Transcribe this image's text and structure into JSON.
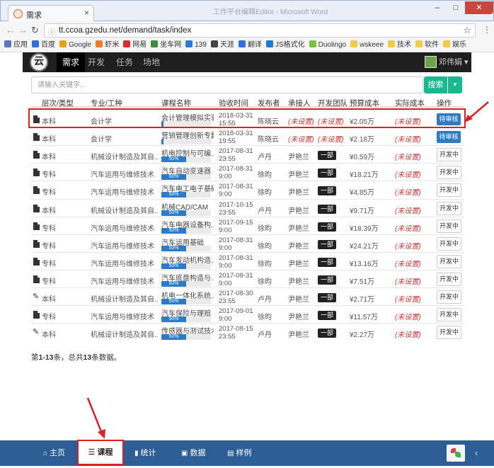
{
  "browser": {
    "tab_title": "需求",
    "caption": "工作平台编辑Editor - Microsoft Word",
    "url": "tt.ccoa.gzedu.net/demand/task/index",
    "bookmarks": [
      {
        "label": "应用",
        "color": "#5a78b8"
      },
      {
        "label": "百度",
        "color": "#2f6fe0"
      },
      {
        "label": "Google",
        "color": "#e8a21a"
      },
      {
        "label": "虾米",
        "color": "#f07b2a"
      },
      {
        "label": "网易",
        "color": "#d62e2e"
      },
      {
        "label": "坐车网",
        "color": "#3a8d3a"
      },
      {
        "label": "139",
        "color": "#2d7bd0"
      },
      {
        "label": "天涯",
        "color": "#444"
      },
      {
        "label": "翻译",
        "color": "#2f6fe0"
      },
      {
        "label": "JS格式化",
        "color": "#1d7bd6"
      },
      {
        "label": "Duolingo",
        "color": "#7ac143"
      },
      {
        "label": "wskeee",
        "color": "#f2c94c"
      },
      {
        "label": "技术",
        "color": "#f2c94c"
      },
      {
        "label": "软件",
        "color": "#f2c94c"
      },
      {
        "label": "娱乐",
        "color": "#f2c94c"
      }
    ]
  },
  "navbar": {
    "logo_text": "云",
    "items": [
      "需求",
      "开发",
      "任务",
      "场地"
    ],
    "active": "需求",
    "user": "邓伟娟"
  },
  "search": {
    "placeholder": "请输入关键字...",
    "button": "搜索",
    "caret": "▼"
  },
  "table": {
    "headers": [
      "层次/类型",
      "专业/工种",
      "课程名称",
      "验收时间",
      "发布者",
      "承接人",
      "开发团队",
      "预算成本",
      "实际成本",
      "操作"
    ],
    "rows": [
      {
        "icon": "doc",
        "level": "本科",
        "major": "会计学",
        "course": "会计管理模拟实验",
        "progress": 0,
        "progress_label": "0%",
        "date1": "2018-03-31",
        "date2": "15:55",
        "publisher": "陈晓云",
        "taker": "(未设置)",
        "team": "(未设置)",
        "budget": "¥2.05万",
        "actual": "(未设置)",
        "action": "待审核",
        "highlight": true
      },
      {
        "icon": "doc",
        "level": "本科",
        "major": "会计学",
        "course": "营销管理创新专题",
        "progress": 0,
        "progress_label": "0%",
        "date1": "2018-03-31",
        "date2": "19:55",
        "publisher": "陈晓云",
        "taker": "(未设置)",
        "team": "(未设置)",
        "budget": "¥2.18万",
        "actual": "(未设置)",
        "action": "待审核"
      },
      {
        "icon": "doc",
        "level": "本科",
        "major": "机械设计制造及其自...",
        "course": "机电控制与可编...",
        "progress": 50,
        "progress_label": "50%",
        "date1": "2017-08-31",
        "date2": "23:55",
        "publisher": "卢丹",
        "taker": "尹艳兰",
        "team": "一部",
        "budget": "¥0.59万",
        "actual": "(未设置)",
        "action": "开发中"
      },
      {
        "icon": "doc",
        "level": "专科",
        "major": "汽车运用与维修技术",
        "course": "汽车自动变速器",
        "progress": 50,
        "progress_label": "50%",
        "date1": "2017-08-31",
        "date2": "9:00",
        "publisher": "徐昀",
        "taker": "尹艳兰",
        "team": "一部",
        "budget": "¥18.21万",
        "actual": "(未设置)",
        "action": "开发中"
      },
      {
        "icon": "doc",
        "level": "专科",
        "major": "汽车运用与维修技术",
        "course": "汽车电工电子基础",
        "progress": 50,
        "progress_label": "50%",
        "date1": "2017-08-31",
        "date2": "9:00",
        "publisher": "徐昀",
        "taker": "尹艳兰",
        "team": "一部",
        "budget": "¥4.85万",
        "actual": "(未设置)",
        "action": "开发中"
      },
      {
        "icon": "doc",
        "level": "本科",
        "major": "机械设计制造及其自...",
        "course": "机械CAD/CAM",
        "progress": 50,
        "progress_label": "50%",
        "date1": "2017-10-15",
        "date2": "23:55",
        "publisher": "卢丹",
        "taker": "尹艳兰",
        "team": "一部",
        "budget": "¥9.71万",
        "actual": "(未设置)",
        "action": "开发中"
      },
      {
        "icon": "doc",
        "level": "专科",
        "major": "汽车运用与维修技术",
        "course": "汽车电器设备构...",
        "progress": 50,
        "progress_label": "50%",
        "date1": "2017-09-15",
        "date2": "9:00",
        "publisher": "徐昀",
        "taker": "尹艳兰",
        "team": "一部",
        "budget": "¥18.39万",
        "actual": "(未设置)",
        "action": "开发中"
      },
      {
        "icon": "doc",
        "level": "专科",
        "major": "汽车运用与维修技术",
        "course": "汽车运用基础",
        "progress": 50,
        "progress_label": "50%",
        "date1": "2017-08-31",
        "date2": "9:00",
        "publisher": "徐昀",
        "taker": "尹艳兰",
        "team": "一部",
        "budget": "¥24.21万",
        "actual": "(未设置)",
        "action": "开发中"
      },
      {
        "icon": "doc",
        "level": "专科",
        "major": "汽车运用与维修技术",
        "course": "汽车发动机构造...",
        "progress": 50,
        "progress_label": "50%",
        "date1": "2017-08-31",
        "date2": "9:00",
        "publisher": "徐昀",
        "taker": "尹艳兰",
        "team": "一部",
        "budget": "¥13.16万",
        "actual": "(未设置)",
        "action": "开发中"
      },
      {
        "icon": "doc",
        "level": "专科",
        "major": "汽车运用与维修技术",
        "course": "汽车底盘构造与...",
        "progress": 50,
        "progress_label": "50%",
        "date1": "2017-08-31",
        "date2": "9:00",
        "publisher": "徐昀",
        "taker": "尹艳兰",
        "team": "一部",
        "budget": "¥7.51万",
        "actual": "(未设置)",
        "action": "开发中"
      },
      {
        "icon": "wrench",
        "level": "本科",
        "major": "机械设计制造及其自...",
        "course": "机电一体化系统...",
        "progress": 50,
        "progress_label": "50%",
        "date1": "2017-08-30",
        "date2": "23:55",
        "publisher": "卢丹",
        "taker": "尹艳兰",
        "team": "一部",
        "budget": "¥2.71万",
        "actual": "(未设置)",
        "action": "开发中"
      },
      {
        "icon": "doc",
        "level": "专科",
        "major": "汽车运用与维修技术",
        "course": "汽车保险与理赔",
        "progress": 50,
        "progress_label": "50%",
        "date1": "2017-09-01",
        "date2": "9:00",
        "publisher": "徐昀",
        "taker": "尹艳兰",
        "team": "一部",
        "budget": "¥11.57万",
        "actual": "(未设置)",
        "action": "开发中"
      },
      {
        "icon": "wrench",
        "level": "本科",
        "major": "机械设计制造及其自...",
        "course": "传感器与测试技术",
        "progress": 50,
        "progress_label": "50%",
        "date1": "2017-08-15",
        "date2": "23:55",
        "publisher": "卢丹",
        "taker": "尹艳兰",
        "team": "一部",
        "budget": "¥2.27万",
        "actual": "(未设置)",
        "action": "开发中"
      }
    ]
  },
  "summary": {
    "prefix": "第",
    "range": "1-13",
    "mid": "条，总共",
    "total": "13",
    "suffix": "条数据。"
  },
  "footer": {
    "home": "主页",
    "course": "课程",
    "stats": "统计",
    "data": "数据",
    "sample": "样例",
    "chevron": "‹"
  },
  "colors": {
    "accent_green": "#18b891",
    "review_blue": "#2d7bc4",
    "footer_blue": "#2c5d94",
    "annotation_red": "#e02020",
    "unset_red": "#c33"
  }
}
